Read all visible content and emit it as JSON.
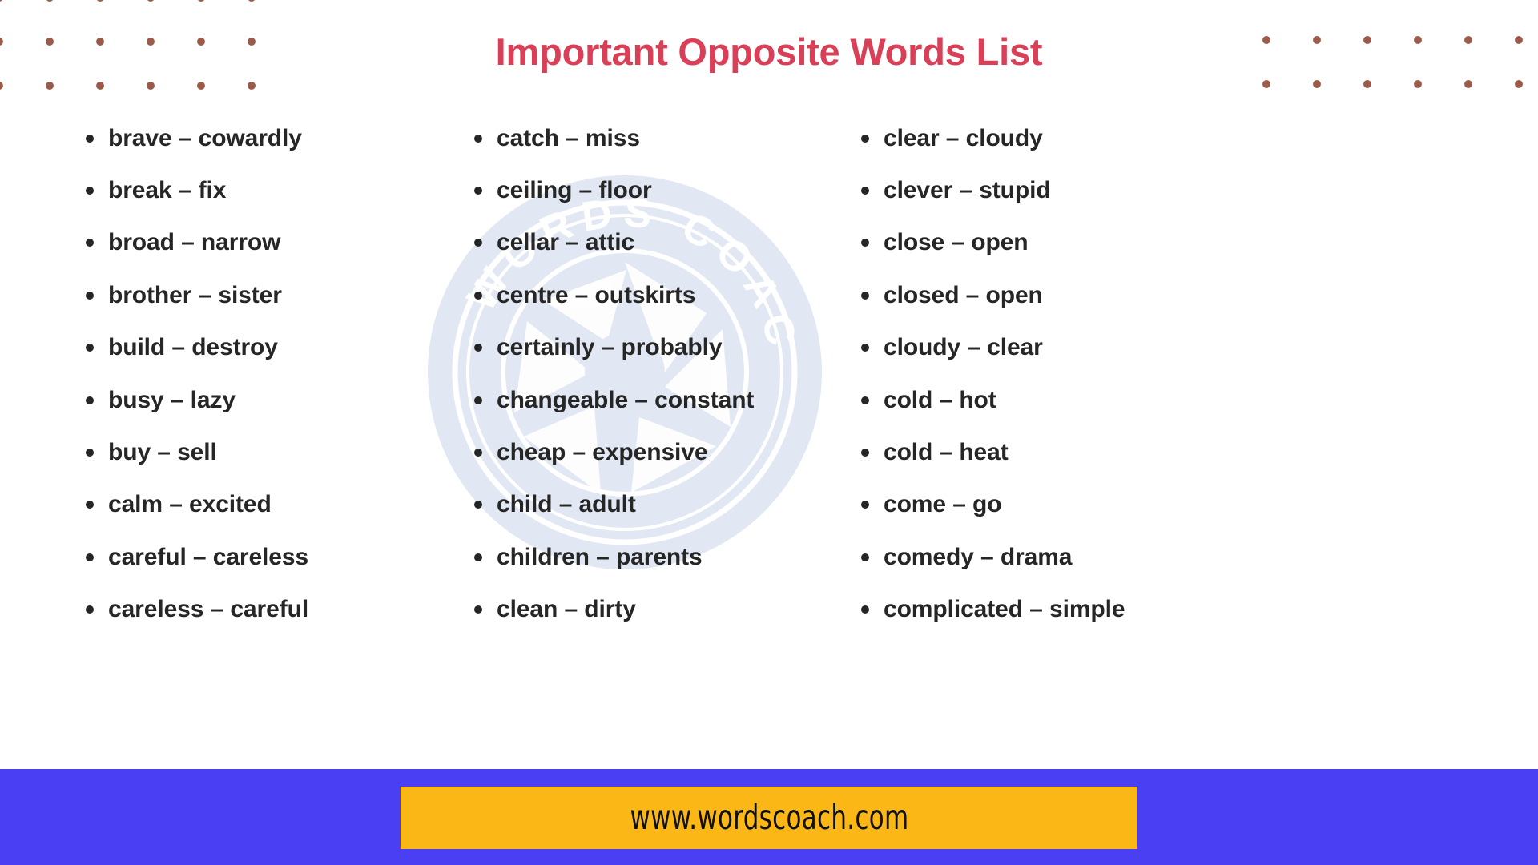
{
  "page": {
    "title": "Important Opposite Words List",
    "title_color": "#D94058",
    "background_color": "#FFFFFF",
    "text_color": "#262626"
  },
  "decoration": {
    "dot_color": "#9B5B4B",
    "dot_grid_left_name": "dot-grid-top-left",
    "dot_grid_right_name": "dot-grid-top-right"
  },
  "watermark": {
    "brand_text": "WORDS COACH",
    "color": "#DDE3F0"
  },
  "columns": [
    {
      "id": "column-1",
      "items": [
        "brave – cowardly",
        "break – fix",
        "broad – narrow",
        "brother – sister",
        "build – destroy",
        "busy – lazy",
        "buy – sell",
        "calm – excited",
        "careful – careless",
        "careless – careful"
      ]
    },
    {
      "id": "column-2",
      "items": [
        "catch – miss",
        "ceiling – floor",
        "cellar – attic",
        "centre – outskirts",
        "certainly – probably",
        "changeable – constant",
        "cheap – expensive",
        "child – adult",
        "children – parents",
        "clean – dirty"
      ]
    },
    {
      "id": "column-3",
      "items": [
        "clear – cloudy",
        "clever – stupid",
        "close – open",
        "closed – open",
        "cloudy – clear",
        "cold – hot",
        "cold – heat",
        "come – go",
        "comedy – drama",
        "complicated – simple"
      ]
    }
  ],
  "footer": {
    "url": "www.wordscoach.com",
    "bar_color": "#4B3FF4",
    "box_color": "#FBB715"
  }
}
